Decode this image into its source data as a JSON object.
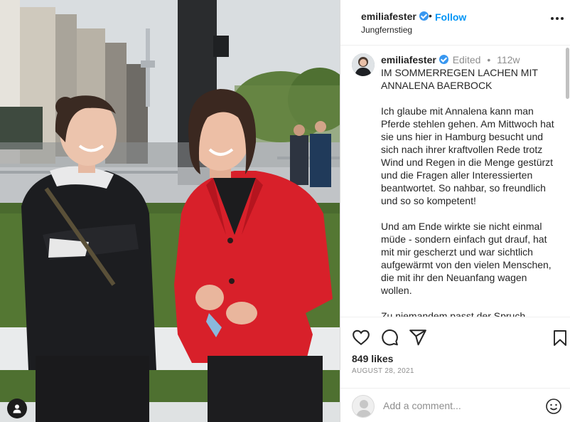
{
  "post": {
    "username": "emiliafester",
    "follow_label": "Follow",
    "dot": "•",
    "location": "Jungfernstieg",
    "more_icon": "more-horizontal-icon"
  },
  "caption": {
    "username": "emiliafester",
    "edited": "Edited",
    "separator": "•",
    "time": "112w",
    "title": "IM SOMMERREGEN LACHEN MIT ANNALENA BAERBOCK",
    "paragraph1": "Ich glaube mit Annalena kann man Pferde stehlen gehen. Am Mittwoch hat sie uns hier in Hamburg besucht und sich nach ihrer kraftvollen Rede trotz Wind und Regen in die Menge gestürzt und die Fragen aller Interessierten beantwortet. So nahbar, so freundlich und so so kompetent!",
    "paragraph2": "Und am Ende wirkte sie nicht einmal müde - sondern einfach gut drauf, hat mit mir gescherzt und war sichtlich aufgewärmt von den vielen Menschen, die mit ihr den Neuanfang wagen wollen.",
    "paragraph3": "Zu niemandem passt der Spruch"
  },
  "actions": {
    "icons": [
      "heart-icon",
      "comment-icon",
      "share-icon",
      "bookmark-icon"
    ],
    "likes": "849 likes",
    "date": "AUGUST 28, 2021"
  },
  "comment": {
    "placeholder": "Add a comment...",
    "emoji_icon": "emoji-icon"
  },
  "colors": {
    "accent": "#0095f6",
    "verified": "#3897f0",
    "text": "#262626",
    "muted": "#8e8e8e"
  }
}
